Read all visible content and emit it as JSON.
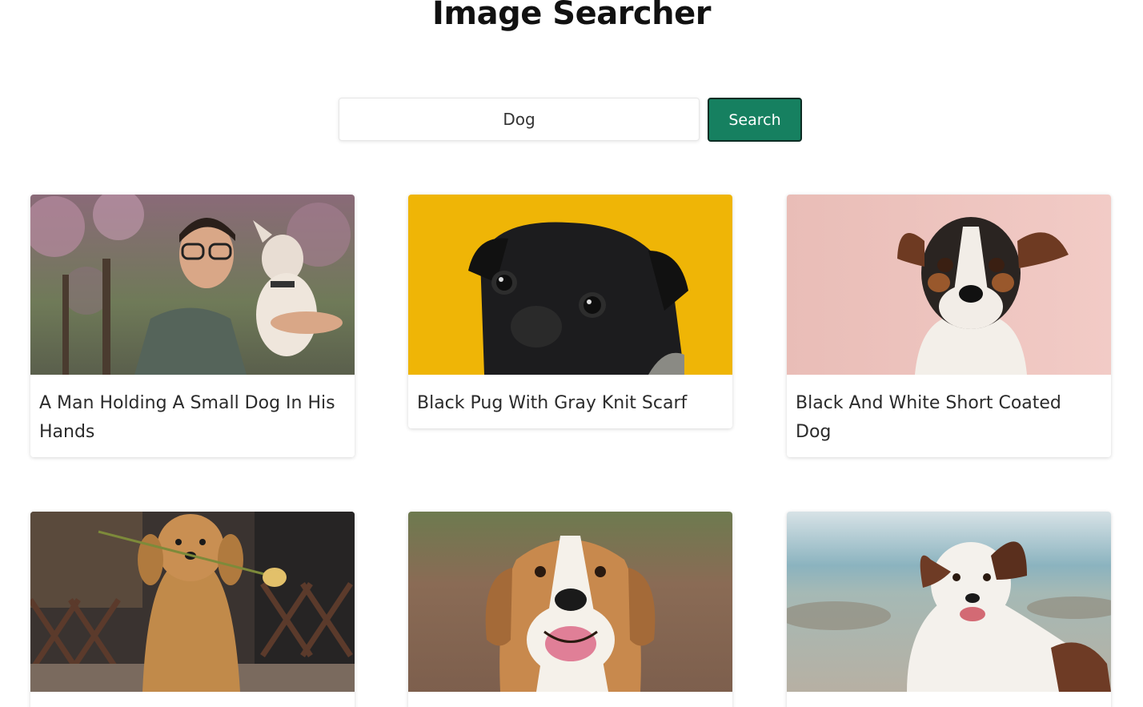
{
  "header": {
    "title": "Image Searcher"
  },
  "search": {
    "value": "Dog",
    "button_label": "Search"
  },
  "results": [
    {
      "caption": "A Man Holding A Small Dog In His Hands"
    },
    {
      "caption": "Black Pug With Gray Knit Scarf"
    },
    {
      "caption": "Black And White Short Coated Dog"
    },
    {
      "caption": ""
    },
    {
      "caption": ""
    },
    {
      "caption": ""
    }
  ],
  "colors": {
    "accent": "#168060",
    "pug_background": "#efb506",
    "terrier_background": "#f0c7c2"
  }
}
